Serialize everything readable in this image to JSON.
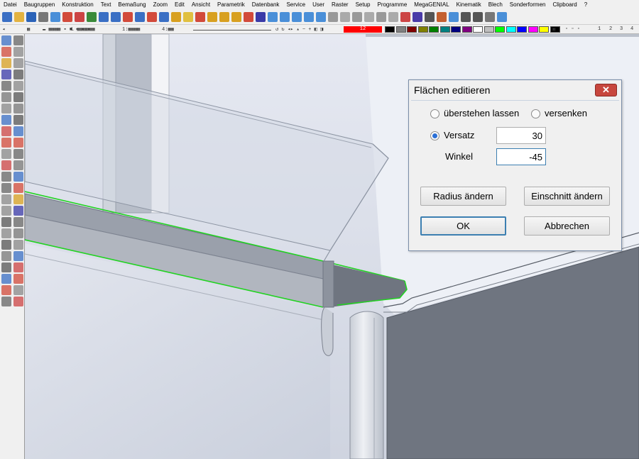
{
  "menu": [
    "Datei",
    "Baugruppen",
    "Konstruktion",
    "Text",
    "Bemaßung",
    "Zoom",
    "Edit",
    "Ansicht",
    "Parametrik",
    "Datenbank",
    "Service",
    "User",
    "Raster",
    "Setup",
    "Programme",
    "MegaGENIAL",
    "Kinematik",
    "Blech",
    "Sonderformen",
    "Clipboard",
    "?"
  ],
  "strip": {
    "s1": "▬ ▦▦▦▦ ▪ ■ ▪ ▪ ▪",
    "s2": "L ▦▦▦▦▦▦",
    "s3": "1:▦▦▦▦",
    "s4": "4:▦▦",
    "layer_number": "12",
    "pages": [
      "1",
      "2",
      "3",
      "4"
    ],
    "colors": [
      "#000000",
      "#808080",
      "#800000",
      "#808000",
      "#008000",
      "#008080",
      "#000080",
      "#800080",
      "#ffffff",
      "#c0c0c0",
      "#00ff00",
      "#00ffff",
      "#0000ff",
      "#ff00ff",
      "#ffff00",
      "#000000"
    ]
  },
  "dialog": {
    "title": "Flächen editieren",
    "close": "✕",
    "opt1": "überstehen lassen",
    "opt2": "versenken",
    "opt3": "Versatz",
    "versatz_value": "30",
    "winkel_label": "Winkel",
    "winkel_value": "-45",
    "btn_radius": "Radius ändern",
    "btn_einschnitt": "Einschnitt ändern",
    "btn_ok": "OK",
    "btn_cancel": "Abbrechen"
  }
}
